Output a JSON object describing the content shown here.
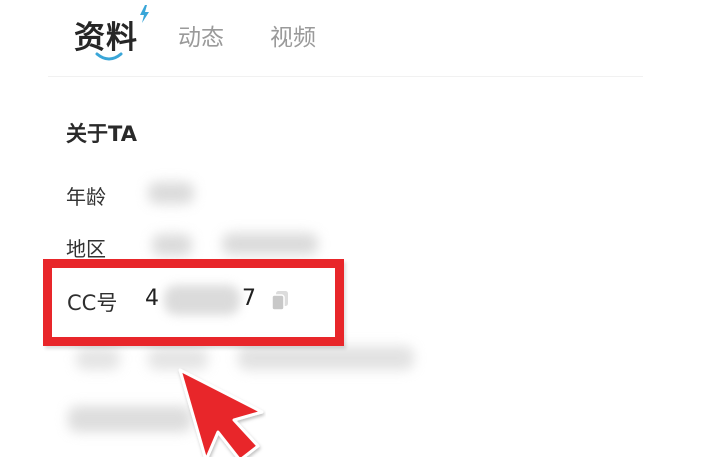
{
  "tabs": {
    "active": "资料",
    "items": [
      "动态",
      "视频"
    ]
  },
  "about": {
    "title": "关于TA",
    "age_label": "年龄",
    "region_label": "地区",
    "cc_label": "CC号",
    "cc_first_digit": "4",
    "cc_last_digit": "7"
  },
  "icons": {
    "copy": "copy-icon",
    "sparkle": "sparkle-icon"
  },
  "colors": {
    "highlight": "#e8262a",
    "tab_active": "#262626",
    "tab_inactive": "#9a9a9a",
    "accent": "#3aa6d8"
  }
}
